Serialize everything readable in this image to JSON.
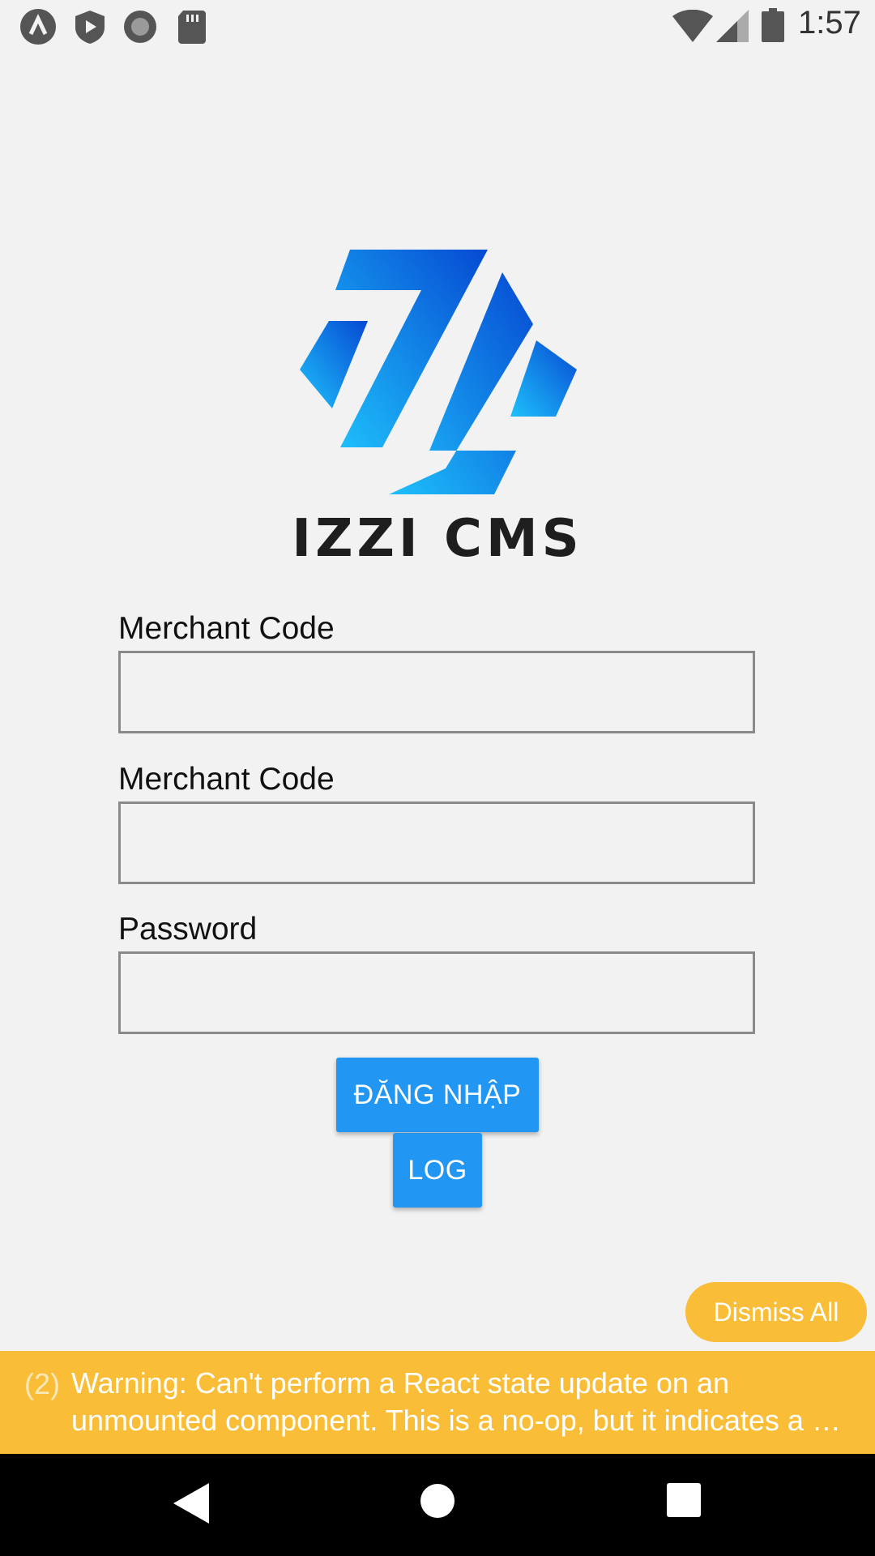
{
  "status_bar": {
    "time": "1:57",
    "left_icons": [
      "app-notification-icon",
      "shield-play-icon",
      "record-icon",
      "sd-card-icon"
    ],
    "right_icons": [
      "wifi-icon",
      "signal-icon",
      "battery-icon"
    ]
  },
  "logo": {
    "text": "IZZI CMS",
    "colors": [
      "#1ea8f6",
      "#0a5fd8"
    ]
  },
  "form": {
    "fields": [
      {
        "label": "Merchant Code",
        "value": ""
      },
      {
        "label": "Merchant Code",
        "value": ""
      },
      {
        "label": "Password",
        "value": ""
      }
    ],
    "login_button": "ĐĂNG NHẬP",
    "log_button": "LOG"
  },
  "warning": {
    "dismiss_label": "Dismiss All",
    "count": "(2)",
    "message": "Warning: Can't perform a React state update on an unmounted component. This is a no-op, but it indicates a …"
  },
  "nav_bar": {
    "icons": [
      "back-icon",
      "home-icon",
      "recents-icon"
    ]
  },
  "colors": {
    "accent": "#2196f3",
    "warning": "#f9bd37",
    "background": "#f2f2f3"
  }
}
